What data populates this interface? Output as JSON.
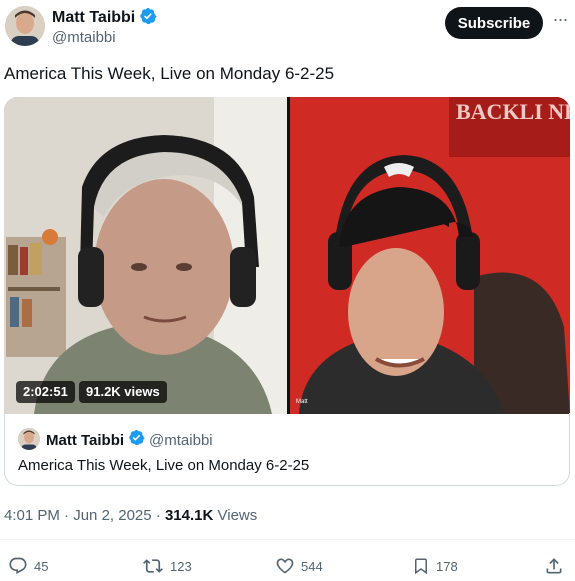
{
  "author": {
    "name": "Matt Taibbi",
    "handle": "@mtaibbi"
  },
  "subscribe_label": "Subscribe",
  "more_label": "···",
  "tweet_text": "America This Week, Live on Monday 6-2-25",
  "video": {
    "duration": "2:02:51",
    "views": "91.2K views",
    "overlay_left": "",
    "overlay_right_top": "BACKLI NEWS",
    "overlay_right_label": "Matt"
  },
  "quote": {
    "name": "Matt Taibbi",
    "handle": "@mtaibbi",
    "text": "America This Week, Live on Monday 6-2-25"
  },
  "meta": {
    "time": "4:01 PM",
    "separator1": " · ",
    "date": "Jun 2, 2025",
    "separator2": " · ",
    "views_count": "314.1K",
    "views_label": " Views"
  },
  "actions": {
    "replies": "45",
    "reposts": "123",
    "likes": "544",
    "bookmarks": "178"
  },
  "colors": {
    "verified": "#1d9bf0",
    "text_primary": "#0f1419",
    "text_secondary": "#536471",
    "red_wall": "#c9221d"
  },
  "icons": [
    "verified-badge-icon",
    "reply-icon",
    "repost-icon",
    "like-icon",
    "bookmark-icon",
    "share-icon"
  ]
}
